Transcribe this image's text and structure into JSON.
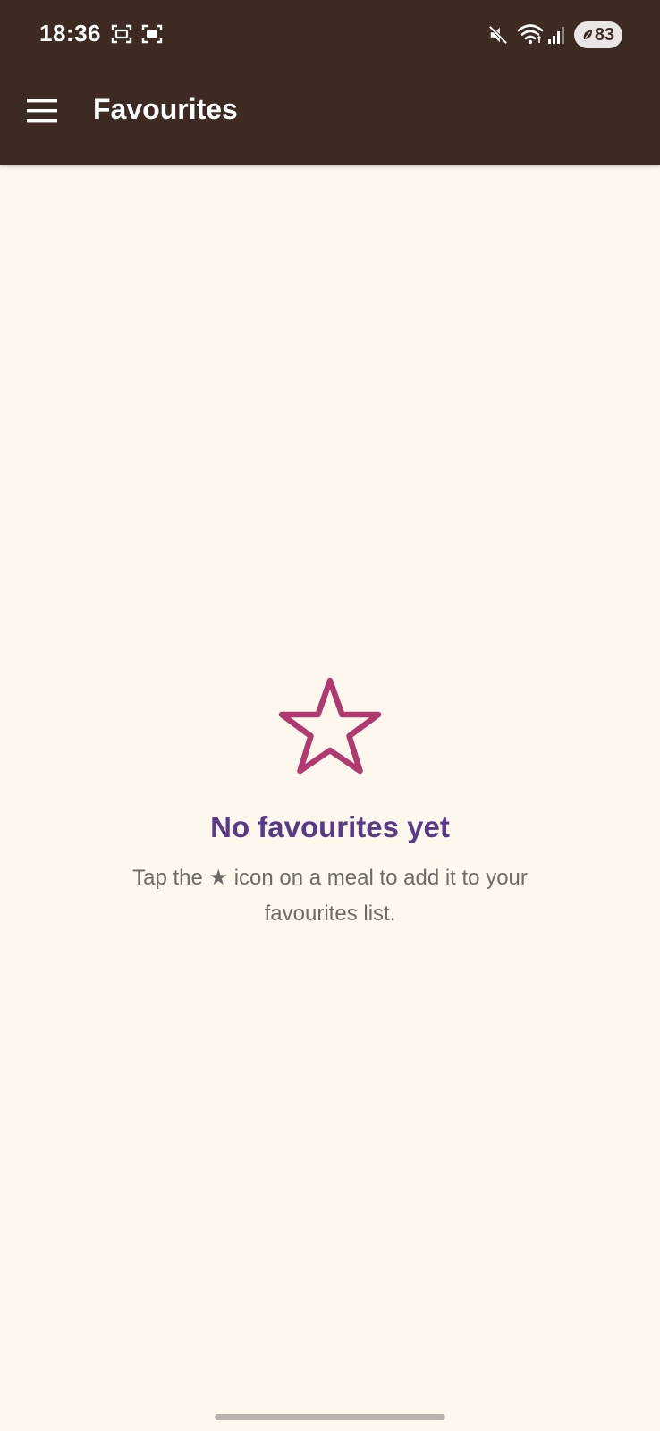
{
  "status_bar": {
    "time": "18:36",
    "battery_level": "83",
    "icons": [
      "screenshot-icon",
      "scan-icon",
      "mute-icon",
      "wifi-icon",
      "signal-icon",
      "battery-saver-icon"
    ]
  },
  "app_bar": {
    "title": "Favourites",
    "menu_icon": "hamburger-menu-icon"
  },
  "empty_state": {
    "icon": "star-outline-icon",
    "title": "No favourites yet",
    "description": "Tap the ★ icon on a meal to add it to your favourites list."
  },
  "colors": {
    "app_bar": "#3d2b23",
    "background": "#fdf7ee",
    "star": "#b03a6f",
    "title": "#5a3a86",
    "description": "#6f6a66"
  }
}
